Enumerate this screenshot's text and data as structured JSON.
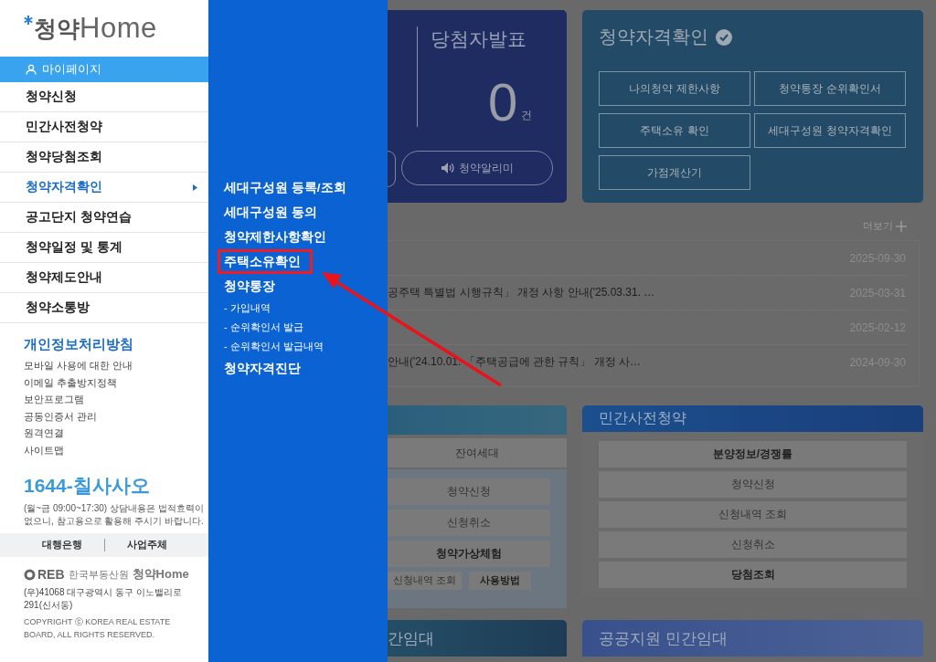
{
  "sidebar": {
    "logo": {
      "text": "청약",
      "home": "Home"
    },
    "mypage": "마이페이지",
    "menu": [
      {
        "label": "청약신청",
        "selected": false
      },
      {
        "label": "민간사전청약",
        "selected": false
      },
      {
        "label": "청약당첨조회",
        "selected": false
      },
      {
        "label": "청약자격확인",
        "selected": true
      },
      {
        "label": "공고단지 청약연습",
        "selected": false
      },
      {
        "label": "청약일정 및 통계",
        "selected": false
      },
      {
        "label": "청약제도안내",
        "selected": false
      },
      {
        "label": "청약소통방",
        "selected": false
      }
    ],
    "policy": "개인정보처리방침",
    "links": [
      "모바일 사용에 대한 안내",
      "이메일 추출방지정책",
      "보안프로그램",
      "공동인증서 관리",
      "원격연결",
      "사이트맵"
    ],
    "phone": "1644-칠사사오",
    "phone_note": "(월~금 09:00~17:30) 상담내용은 법적효력이 없으니, 참고용으로 활용해 주시기 바랍니다.",
    "footer_tabs": [
      "대행은행",
      "사업주체"
    ],
    "footer": {
      "logo": "REB",
      "org": "한국부동산원",
      "brand_prefix": "청약",
      "brand": "Home",
      "address": "(우)41068 대구광역시 동구 이노밸리로 291(신서동)",
      "copyright": "COPYRIGHT ⓒ KOREA REAL ESTATE BOARD, ALL RIGHTS RESERVED."
    }
  },
  "submenu": [
    {
      "label": "세대구성원 등록/조회",
      "kind": "main",
      "highlighted": false
    },
    {
      "label": "세대구성원 동의",
      "kind": "main",
      "highlighted": false
    },
    {
      "label": "청약제한사항확인",
      "kind": "main",
      "highlighted": false
    },
    {
      "label": "주택소유확인",
      "kind": "main",
      "highlighted": true
    },
    {
      "label": "청약통장",
      "kind": "main",
      "highlighted": false
    },
    {
      "label": "- 가입내역",
      "kind": "sub",
      "highlighted": false
    },
    {
      "label": "- 순위확인서 발급",
      "kind": "sub",
      "highlighted": false
    },
    {
      "label": "- 순위확인서 발급내역",
      "kind": "sub",
      "highlighted": false
    },
    {
      "label": "청약자격진단",
      "kind": "main",
      "highlighted": false
    }
  ],
  "winners": {
    "title": "당첨자발표",
    "count": "0",
    "unit": "건",
    "alert_button": "청약알리미"
  },
  "eligibility": {
    "title": "청약자격확인",
    "buttons": [
      "나의청약 제한사항",
      "청약통장 순위확인서",
      "주택소유 확인",
      "세대구성원 청약자격확인",
      "가점계산기"
    ]
  },
  "notices": {
    "more": "더보기",
    "rows": [
      {
        "date": "2025-09-30"
      },
      {
        "title": "공주택 특별법 시행규칙」 개정 사항 안내('25.03.31. …",
        "date": "2025-03-31"
      },
      {
        "date": "2025-02-12"
      },
      {
        "title": "안내('24.10.01. 「주택공급에 관한 규칙」 개정 사…",
        "date": "2024-09-30"
      }
    ]
  },
  "apply_card": {
    "tab": "잔여세대",
    "buttons": [
      {
        "label": "청약신청",
        "disabled": true
      },
      {
        "label": "신청취소",
        "disabled": true
      },
      {
        "label": "청약가상체험",
        "disabled": false
      }
    ],
    "small_buttons": [
      {
        "label": "신청내역 조회",
        "disabled": true
      },
      {
        "label": "사용방법",
        "disabled": false
      }
    ]
  },
  "presale": {
    "title": "민간사전청약",
    "rows": [
      {
        "label": "분양정보/경쟁률",
        "disabled": false
      },
      {
        "label": "청약신청",
        "disabled": true
      },
      {
        "label": "신청내역 조회",
        "disabled": true
      },
      {
        "label": "신청취소",
        "disabled": true
      },
      {
        "label": "당첨조회",
        "disabled": false
      }
    ]
  },
  "rentals": [
    {
      "title": "간임대",
      "kind": "teal"
    },
    {
      "title": "공공지원 민간임대",
      "kind": "indigo"
    }
  ]
}
